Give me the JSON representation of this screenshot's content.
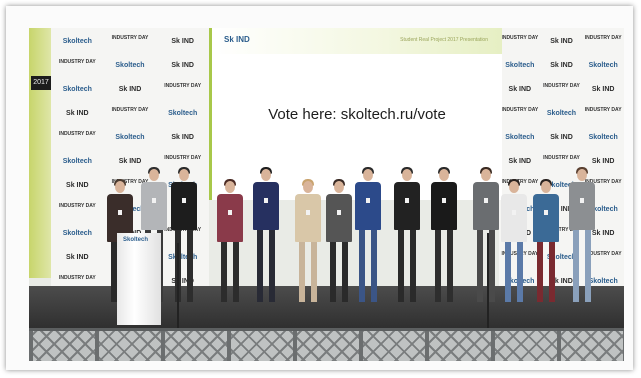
{
  "screen": {
    "logo": "Sk IND",
    "header": "Student Real Project 2017 Presentation",
    "vote_text": "Vote here: skoltech.ru/vote"
  },
  "banner": {
    "logos": [
      "Skoltech",
      "INDUSTRY DAY",
      "Sk IND",
      "INDUSTRY DAY",
      "Skoltech",
      "Sk IND",
      "Skoltech",
      "Sk IND",
      "INDUSTRY DAY",
      "Sk IND",
      "INDUSTRY DAY",
      "Skoltech",
      "INDUSTRY DAY",
      "Skoltech",
      "Sk IND",
      "Skoltech",
      "Sk IND",
      "INDUSTRY DAY",
      "Sk IND",
      "INDUSTRY DAY",
      "Skoltech",
      "INDUSTRY DAY",
      "Skoltech",
      "Sk IND",
      "Skoltech",
      "Sk IND",
      "INDUSTRY DAY",
      "Sk IND",
      "INDUSTRY DAY",
      "Skoltech",
      "INDUSTRY DAY",
      "Skoltech",
      "Sk IND"
    ]
  },
  "lectern": {
    "label": "Skoltech"
  },
  "wall_sign": "2017",
  "colors": {
    "brand_blue": "#2b5d8c",
    "accent_green": "#a8c84a"
  }
}
